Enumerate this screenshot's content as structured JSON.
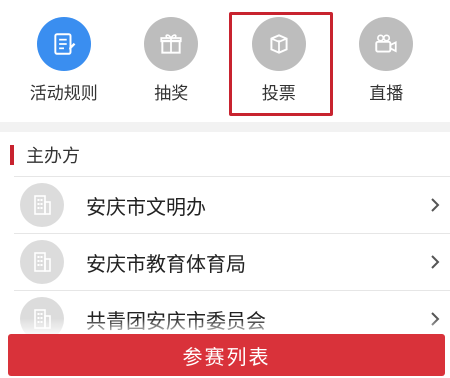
{
  "nav": {
    "items": [
      {
        "label": "活动规则",
        "icon": "document-icon",
        "color": "#3a8ef0",
        "selected": false
      },
      {
        "label": "抽奖",
        "icon": "gift-icon",
        "color": "#bdbdbd",
        "selected": false
      },
      {
        "label": "投票",
        "icon": "ballot-box-icon",
        "color": "#bdbdbd",
        "selected": true
      },
      {
        "label": "直播",
        "icon": "video-camera-icon",
        "color": "#bdbdbd",
        "selected": false
      }
    ]
  },
  "organizers": {
    "title": "主办方",
    "items": [
      {
        "name": "安庆市文明办",
        "icon": "building-icon"
      },
      {
        "name": "安庆市教育体育局",
        "icon": "building-icon"
      },
      {
        "name": "共青团安庆市委员会",
        "icon": "building-icon"
      }
    ]
  },
  "footer": {
    "button_label": "参赛列表",
    "color": "#d9323a"
  },
  "accent": "#c8232f"
}
